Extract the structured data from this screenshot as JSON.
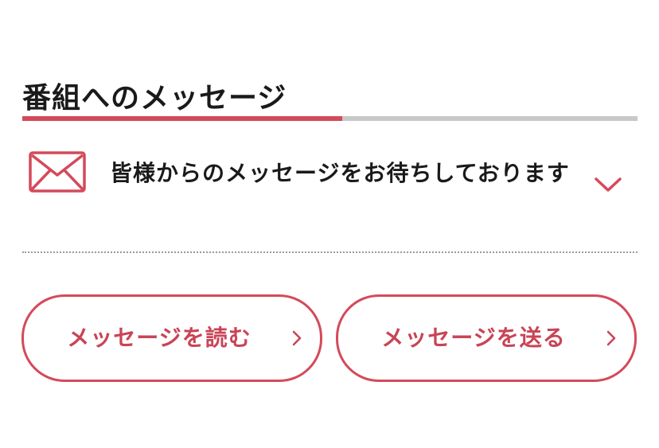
{
  "section": {
    "title": "番組へのメッセージ"
  },
  "progress": {
    "fraction": 0.52
  },
  "accordion": {
    "text": "皆様からのメッセージをお待ちしております",
    "icon": "mail-icon",
    "toggle_icon": "chevron-down-icon"
  },
  "buttons": {
    "read_label": "メッセージを読む",
    "send_label": "メッセージを送る",
    "arrow_icon": "chevron-right-icon"
  },
  "colors": {
    "accent": "#d44a5a",
    "track": "#c8c8c8",
    "text": "#1a1a1a",
    "divider": "#9a9a9a"
  }
}
